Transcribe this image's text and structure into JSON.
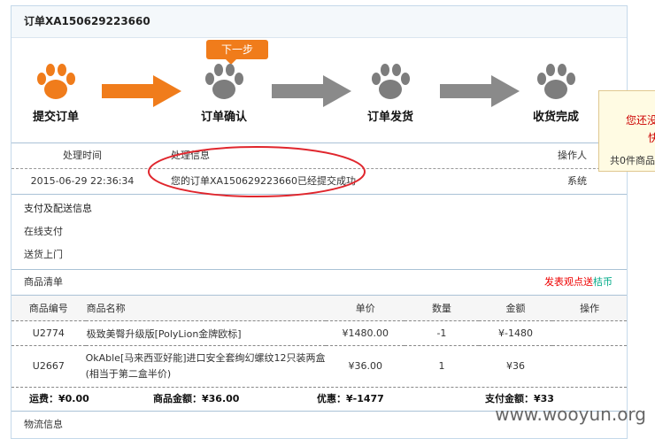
{
  "order": {
    "title": "订单XA150629223660"
  },
  "steps": {
    "labels": [
      "提交订单",
      "订单确认",
      "订单发货",
      "收货完成"
    ],
    "next_bubble": "下一步",
    "active_color": "#f07c1b"
  },
  "log": {
    "headers": {
      "time": "处理时间",
      "msg": "处理信息",
      "op": "操作人"
    },
    "row": {
      "time": "2015-06-29 22:36:34",
      "msg": "您的订单XA150629223660已经提交成功",
      "op": "系统"
    }
  },
  "payment": {
    "title": "支付及配送信息",
    "method": "在线支付",
    "delivery": "送货上门"
  },
  "goods": {
    "title": "商品清单",
    "opinion": "发表观点送",
    "opinion_suffix": "桔币",
    "columns": [
      "商品编号",
      "商品名称",
      "单价",
      "数量",
      "金额",
      "操作"
    ],
    "rows": [
      {
        "code": "U2774",
        "name": "极致美臀升级版[PolyLion金牌欧标]",
        "price": "¥1480.00",
        "qty": "-1",
        "amount": "¥-1480",
        "op": ""
      },
      {
        "code": "U2667",
        "name": "OkAble[马来西亚好能]进口安全套绚幻螺纹12只装两盒(相当于第二盒半价)",
        "price": "¥36.00",
        "qty": "1",
        "amount": "¥36",
        "op": ""
      }
    ]
  },
  "summary": {
    "shipping": "运费：¥0.00",
    "goods_total": "商品金额：¥36.00",
    "discount": "优惠：¥-1477",
    "pay_total": "支付金额：¥33"
  },
  "logistics": {
    "title": "物流信息"
  },
  "side_popup": {
    "line1": "您还没",
    "line2": "快",
    "line3": "共0件商品"
  },
  "watermark": "www.wooyun.org"
}
